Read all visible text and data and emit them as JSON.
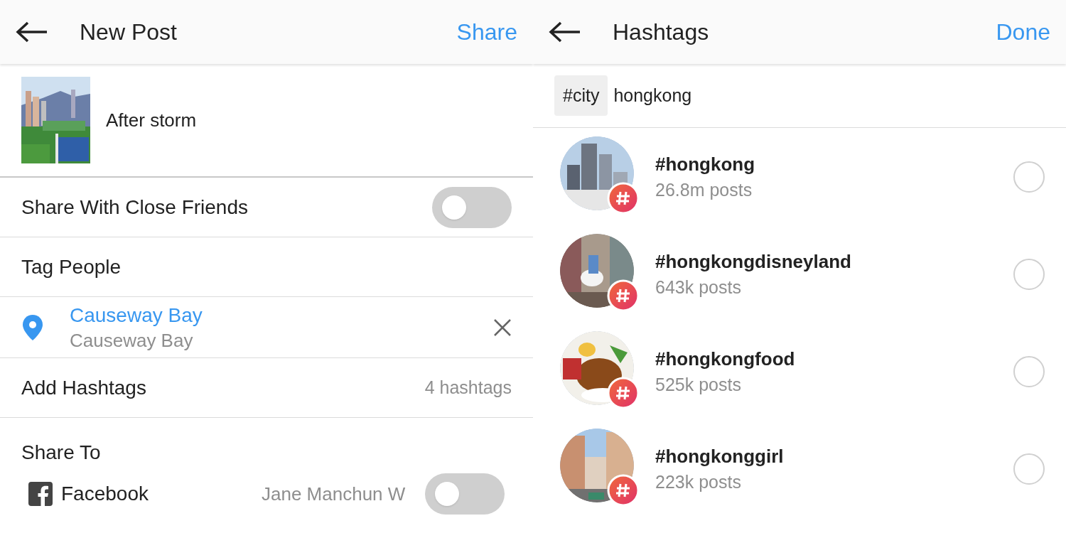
{
  "new_post": {
    "title": "New Post",
    "action": "Share",
    "caption": "After storm",
    "close_friends": {
      "label": "Share With Close Friends",
      "on": false
    },
    "tag_people": {
      "label": "Tag People"
    },
    "location": {
      "name": "Causeway Bay",
      "address": "Causeway Bay"
    },
    "hashtags": {
      "label": "Add Hashtags",
      "count": "4 hashtags"
    },
    "share_to": {
      "heading": "Share To",
      "accounts": [
        {
          "network": "Facebook",
          "account": "Jane Manchun W",
          "on": false
        }
      ]
    }
  },
  "hashtags_screen": {
    "title": "Hashtags",
    "action": "Done",
    "chips": [
      "#city"
    ],
    "query": "hongkong",
    "results": [
      {
        "tag": "#hongkong",
        "posts": "26.8m posts",
        "selected": false,
        "kind": "picture"
      },
      {
        "tag": "#hongkongdisneyland",
        "posts": "643k posts",
        "selected": false,
        "kind": "picture"
      },
      {
        "tag": "#hongkongfood",
        "posts": "525k posts",
        "selected": false,
        "kind": "picture"
      },
      {
        "tag": "#hongkonggirl",
        "posts": "223k posts",
        "selected": false,
        "kind": "picture"
      }
    ]
  }
}
